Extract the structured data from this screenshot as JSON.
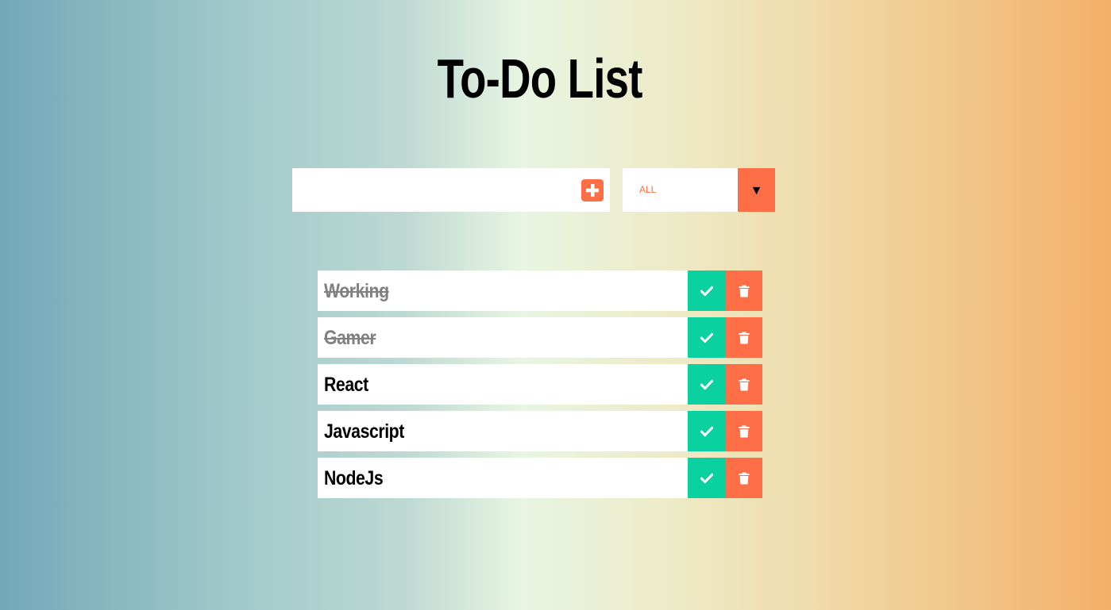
{
  "header": {
    "title": "To-Do List"
  },
  "form": {
    "input_value": "",
    "input_placeholder": "",
    "add_icon": "plus-square-icon",
    "filter": {
      "selected": "ALL",
      "arrow": "▼"
    }
  },
  "todos": [
    {
      "text": "Working",
      "completed": true
    },
    {
      "text": "Gamer",
      "completed": true
    },
    {
      "text": "React",
      "completed": false
    },
    {
      "text": "Javascript",
      "completed": false
    },
    {
      "text": "NodeJs",
      "completed": false
    }
  ],
  "icons": {
    "complete": "check-icon",
    "delete": "trash-icon"
  },
  "colors": {
    "accent": "#ff6f47",
    "complete": "#0bd0a0",
    "completed_text": "#808080"
  }
}
